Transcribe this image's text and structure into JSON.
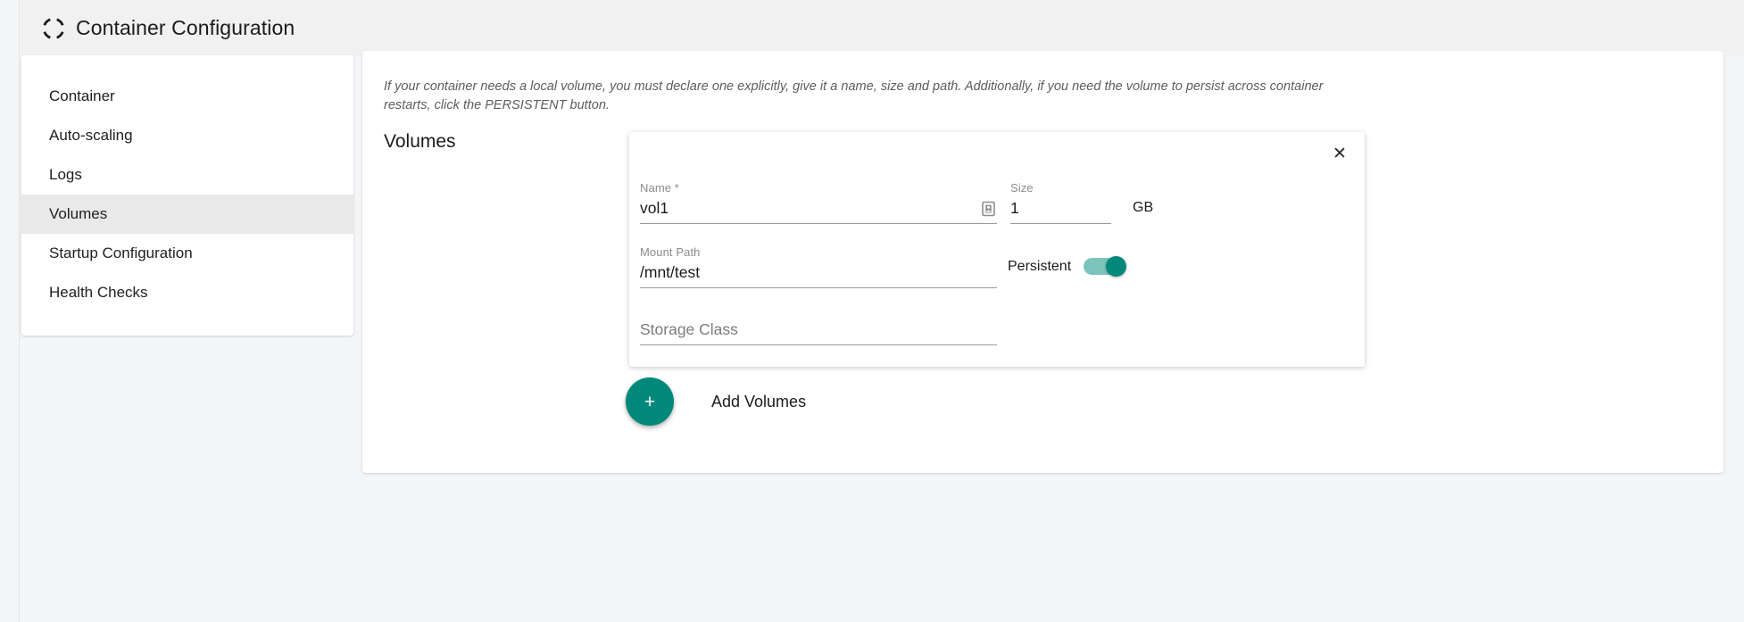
{
  "header": {
    "title": "Container Configuration",
    "icon": "container-circle-icon"
  },
  "sidebar": {
    "items": [
      {
        "label": "Container",
        "selected": false
      },
      {
        "label": "Auto-scaling",
        "selected": false
      },
      {
        "label": "Logs",
        "selected": false
      },
      {
        "label": "Volumes",
        "selected": true
      },
      {
        "label": "Startup Configuration",
        "selected": false
      },
      {
        "label": "Health Checks",
        "selected": false
      }
    ]
  },
  "main": {
    "intro": "If your container needs a local volume, you must declare one explicitly, give it a name, size and path. Additionally, if you need the volume to persist across container restarts, click the PERSISTENT button.",
    "section_title": "Volumes",
    "add_button": {
      "icon": "plus-icon",
      "label": "Add Volumes"
    }
  },
  "volume_form": {
    "close_icon": "close-icon",
    "name": {
      "label": "Name *",
      "value": "vol1",
      "trailing_icon": "badge-icon"
    },
    "size": {
      "label": "Size",
      "value": "1",
      "unit": "GB"
    },
    "mount_path": {
      "label": "Mount Path",
      "value": "/mnt/test"
    },
    "persistent": {
      "label": "Persistent",
      "state": "on"
    },
    "storage_class": {
      "label": "",
      "placeholder": "Storage Class",
      "value": ""
    }
  },
  "colors": {
    "accent": "#00897b",
    "accent_track": "#7cc4bb",
    "page_bg": "#f4f5f7",
    "header_bg": "#f1f1f2",
    "selected_item_bg": "#e9e9e9"
  }
}
